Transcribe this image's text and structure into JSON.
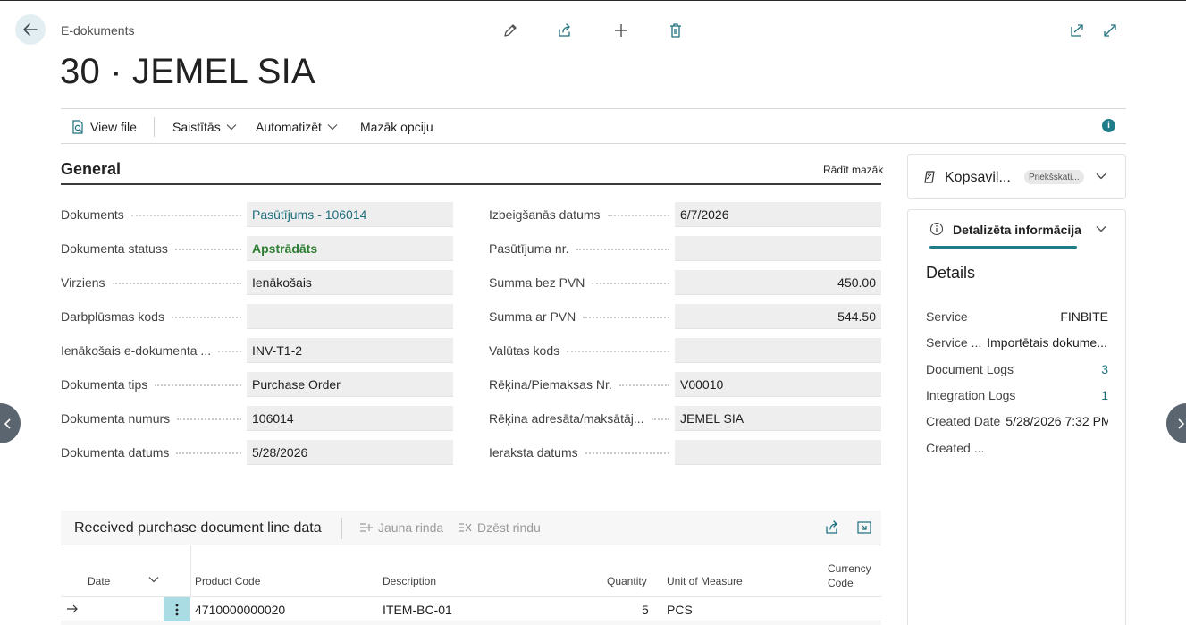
{
  "header": {
    "breadcrumb": "E-dokuments",
    "title": "30 · JEMEL SIA"
  },
  "actions": {
    "view_file": "View file",
    "related": "Saistītās",
    "automate": "Automatizēt",
    "fewer_options": "Mazāk opciju"
  },
  "general": {
    "title": "General",
    "show_less": "Rādīt mazāk",
    "left_fields": [
      {
        "label": "Dokuments",
        "value": "Pasūtījums - 106014"
      },
      {
        "label": "Dokumenta statuss",
        "value": "Apstrādāts"
      },
      {
        "label": "Virziens",
        "value": "Ienākošais"
      },
      {
        "label": "Darbplūsmas kods",
        "value": ""
      },
      {
        "label": "Ienākošais e-dokumenta ...",
        "value": "INV-T1-2"
      },
      {
        "label": "Dokumenta tips",
        "value": "Purchase Order"
      },
      {
        "label": "Dokumenta numurs",
        "value": "106014"
      },
      {
        "label": "Dokumenta datums",
        "value": "5/28/2026"
      }
    ],
    "right_fields": [
      {
        "label": "Izbeigšanās datums",
        "value": "6/7/2026"
      },
      {
        "label": "Pasūtījuma nr.",
        "value": ""
      },
      {
        "label": "Summa bez PVN",
        "value": "450.00"
      },
      {
        "label": "Summa ar PVN",
        "value": "544.50"
      },
      {
        "label": "Valūtas kods",
        "value": ""
      },
      {
        "label": "Rēķina/Piemaksas Nr.",
        "value": "V00010"
      },
      {
        "label": "Rēķina adresāta/maksātāj...",
        "value": "JEMEL SIA"
      },
      {
        "label": "Ieraksta datums",
        "value": ""
      }
    ]
  },
  "factbox": {
    "summary_title": "Kopsavil...",
    "summary_badge": "Priekšskati...",
    "details_tab": "Detalizēta informācija",
    "details_heading": "Details",
    "rows": [
      {
        "key": "Service",
        "value": "FINBITE"
      },
      {
        "key": "Service ...",
        "value": "Importētais dokume..."
      },
      {
        "key": "Document Logs",
        "value": "3"
      },
      {
        "key": "Integration Logs",
        "value": "1"
      },
      {
        "key": "Created Date",
        "value": "5/28/2026 7:32 PM"
      },
      {
        "key": "Created ...",
        "value": ""
      }
    ]
  },
  "lines": {
    "title": "Received purchase document line data",
    "new_line": "Jauna rinda",
    "delete_line": "Dzēst rindu",
    "columns": {
      "date": "Date",
      "product_code": "Product Code",
      "description": "Description",
      "quantity": "Quantity",
      "unit_of_measure": "Unit of Measure",
      "currency_code_1": "Currency",
      "currency_code_2": "Code"
    },
    "row": {
      "product_code": "4710000000020",
      "description": "ITEM-BC-01",
      "quantity": "5",
      "unit_of_measure": "PCS"
    }
  },
  "colors": {
    "accent": "#1e7d89",
    "link": "#1e6f7d",
    "status_ok": "#2e7d32",
    "field_bg": "#eeeeee"
  }
}
